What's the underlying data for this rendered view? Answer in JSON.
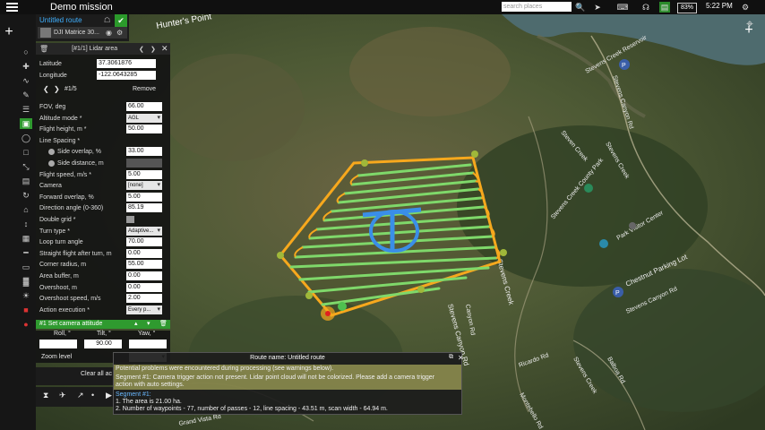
{
  "app": {
    "title": "Demo mission"
  },
  "search": {
    "placeholder": "search places"
  },
  "status": {
    "battery": "83%",
    "time": "5:22 PM"
  },
  "route": {
    "name": "Untitled route",
    "drone": "DJI Matrice 30..."
  },
  "map_labels": {
    "hunters_point": "Hunter's Point",
    "reservoir": "Stevens Creek Reservoir",
    "stevens_canyon": "Stevens Canyon Rd",
    "steven_creek1": "Steven Creek",
    "steven_creek2": "Stevens Creek",
    "stevens_creek_vert": "Stevens Creek",
    "county_park": "Stevens Creek County Park",
    "visitor_center": "Park Visitor Center",
    "chestnut": "Chestnut Parking Lot",
    "canyon_rd2": "Stevens Canyon Rd",
    "balboa": "Balboa Rd",
    "ricardo": "Ricardo Rd",
    "montebello": "Montebello Rd",
    "grand_vista": "Grand Vista Rd",
    "stevens_canyon_rd3": "Stevens Canyon Rd",
    "canyon_rd_vert": "Canyon Rd",
    "stevens_creek_bottom": "Stevens Creek"
  },
  "panel": {
    "header": "[#1/1] Lidar area",
    "latitude_label": "Latitude",
    "latitude": "37.3061876",
    "longitude_label": "Longitude",
    "longitude": "-122.0643285",
    "nav_index": "#1/5",
    "remove": "Remove",
    "fields": [
      {
        "label": "FOV, deg",
        "value": "66.00",
        "kind": "input"
      },
      {
        "label": "Altitude mode *",
        "value": "AGL",
        "kind": "select"
      },
      {
        "label": "Flight height, m *",
        "value": "50.00",
        "kind": "input"
      },
      {
        "label": "Line Spacing *",
        "value": "",
        "kind": "none"
      },
      {
        "label": "Side overlap, %",
        "value": "33.00",
        "kind": "radio-input"
      },
      {
        "label": "Side distance, m",
        "value": "",
        "kind": "radio-input"
      },
      {
        "label": "Flight speed, m/s *",
        "value": "5.00",
        "kind": "input"
      },
      {
        "label": "Camera",
        "value": "[none]",
        "kind": "select"
      },
      {
        "label": "Forward overlap, %",
        "value": "5.00",
        "kind": "input"
      },
      {
        "label": "Direction angle (0-360)",
        "value": "85.19",
        "kind": "input"
      },
      {
        "label": "Double grid *",
        "value": "",
        "kind": "check"
      },
      {
        "label": "Turn type *",
        "value": "Adaptive...",
        "kind": "select"
      },
      {
        "label": "Loop turn angle",
        "value": "70.00",
        "kind": "input"
      },
      {
        "label": "Straight flight after turn, m",
        "value": "0.00",
        "kind": "input"
      },
      {
        "label": "Corner radius, m",
        "value": "55.00",
        "kind": "input"
      },
      {
        "label": "Area buffer, m",
        "value": "0.00",
        "kind": "input"
      },
      {
        "label": "Overshoot, m",
        "value": "0.00",
        "kind": "input"
      },
      {
        "label": "Overshoot speed, m/s",
        "value": "2.00",
        "kind": "input"
      },
      {
        "label": "Action execution *",
        "value": "Every p...",
        "kind": "select"
      }
    ],
    "action_title": "#1 Set camera attitude",
    "roll_label": "Roll, °",
    "tilt_label": "Tilt, °",
    "yaw_label": "Yaw, °",
    "tilt_value": "90.00",
    "zoom_label": "Zoom level",
    "clear_all": "Clear all ac"
  },
  "messages": {
    "title": "Route name: Untitled route",
    "warning_header": "Potential problems were encountered during processing (see warnings below).",
    "warning_line1": "Segment #1: Camera trigger action not present. Lidar point cloud will not be colorized. Please add a camera trigger",
    "warning_line2": "action with auto settings.",
    "segment": "Segment #1:",
    "info1": "1. The area is 21.00 ha.",
    "info2": "2. Number of waypoints - 77, number of passes - 12, line spacing - 43.51 m, scan width - 64.94 m."
  }
}
